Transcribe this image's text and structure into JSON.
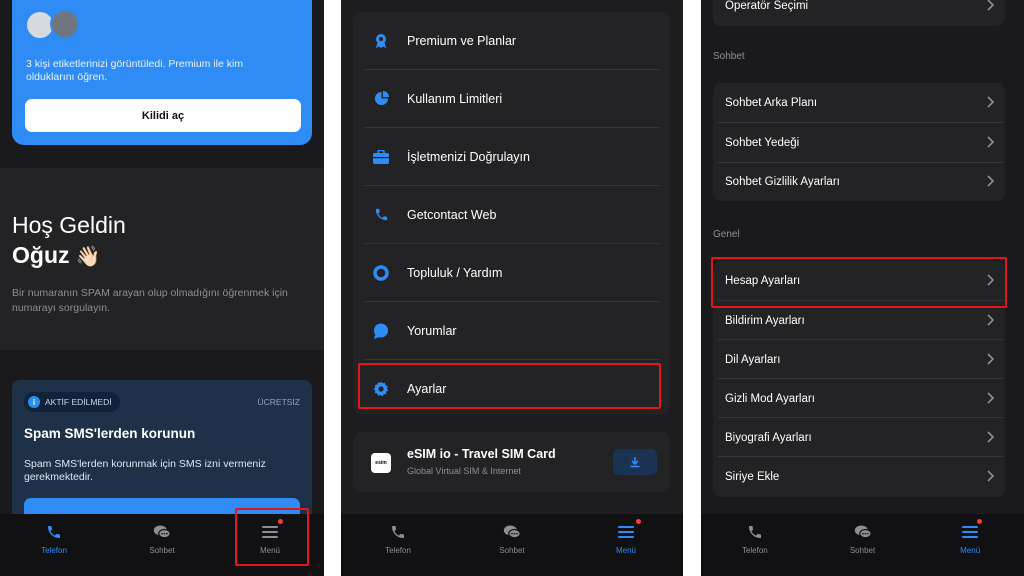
{
  "panel1": {
    "card_text": "3 kişi etiketlerinizi görüntüledi. Premium ile kim olduklarını öğren.",
    "unlock_label": "Kilidi aç",
    "welcome_line1": "Hoş Geldin",
    "welcome_name": "Oğuz",
    "welcome_emoji": "👋🏻",
    "welcome_desc": "Bir numaranın SPAM arayan olup olmadığını öğrenmek için numarayı sorgulayın.",
    "sms_badge": "AKTİF EDİLMEDİ",
    "sms_free": "ÜCRETSİZ",
    "sms_title": "Spam SMS'lerden korunun",
    "sms_desc": "Spam SMS'lerden korunmak için SMS izni vermeniz gerekmektedir."
  },
  "nav": {
    "phone": "Telefon",
    "chat": "Sohbet",
    "menu": "Menü"
  },
  "panel2": {
    "items": [
      {
        "label": "Premium ve Planlar",
        "icon": "award-icon"
      },
      {
        "label": "Kullanım Limitleri",
        "icon": "pie-chart-icon"
      },
      {
        "label": "İşletmenizi Doğrulayın",
        "icon": "briefcase-icon"
      },
      {
        "label": "Getcontact Web",
        "icon": "phone-icon"
      },
      {
        "label": "Topluluk / Yardım",
        "icon": "lifebuoy-icon"
      },
      {
        "label": "Yorumlar",
        "icon": "comment-icon"
      },
      {
        "label": "Ayarlar",
        "icon": "gear-icon"
      }
    ],
    "esim_title": "eSIM io - Travel SIM Card",
    "esim_sub": "Global Virtual SIM & Internet",
    "esim_logo": "esim"
  },
  "panel3": {
    "top_item": "Operatör Seçimi",
    "section_chat": "Sohbet",
    "chat_items": [
      "Sohbet Arka Planı",
      "Sohbet Yedeği",
      "Sohbet Gizlilik Ayarları"
    ],
    "section_general": "Genel",
    "general_items": [
      "Hesap Ayarları",
      "Bildirim Ayarları",
      "Dil Ayarları",
      "Gizli Mod Ayarları",
      "Biyografi Ayarları",
      "Siriye Ekle"
    ]
  },
  "colors": {
    "accent": "#2f8cf4",
    "highlight": "#e0171f",
    "badge_dot": "#ff3b30"
  }
}
